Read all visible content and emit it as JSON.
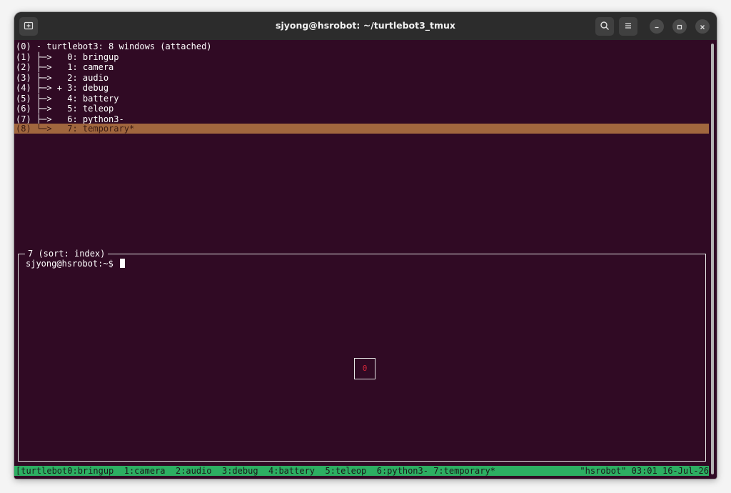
{
  "window": {
    "title": "sjyong@hsrobot: ~/turtlebot3_tmux",
    "icons": {
      "new_tab": "new-tab-icon",
      "search": "search-icon",
      "menu": "hamburger-menu-icon",
      "minimize": "minimize-icon",
      "maximize": "maximize-icon",
      "close": "close-icon"
    }
  },
  "tree": {
    "session_line": "(0) - turtlebot3: 8 windows (attached)",
    "items": [
      {
        "text": "(1) ├─>   0: bringup"
      },
      {
        "text": "(2) ├─>   1: camera"
      },
      {
        "text": "(3) ├─>   2: audio"
      },
      {
        "text": "(4) ├─> + 3: debug"
      },
      {
        "text": "(5) ├─>   4: battery"
      },
      {
        "text": "(6) ├─>   5: teleop"
      },
      {
        "text": "(7) ├─>   6: python3-"
      },
      {
        "text": "(8) └─>   7: temporary*"
      }
    ],
    "selected_index": 7
  },
  "preview": {
    "label": "7 (sort: index)",
    "prompt": "sjyong@hsrobot:~$ ",
    "indicator": "0"
  },
  "status_bar": {
    "left": "[turtlebot0:bringup  1:camera  2:audio  3:debug  4:battery  5:teleop  6:python3- 7:temporary*",
    "right": "\"hsrobot\" 03:01 16-Jul-26"
  },
  "colors": {
    "terminal_bg": "#300a24",
    "titlebar_bg": "#2c2c2c",
    "selection": "#a1673e",
    "status_bar": "#2dae62",
    "indicator_text": "#d3263a"
  }
}
